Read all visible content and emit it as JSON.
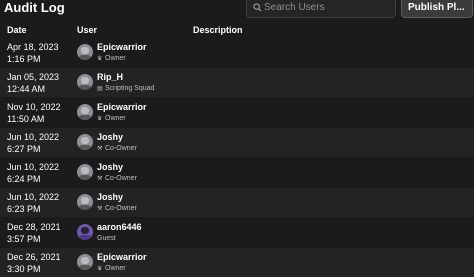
{
  "header": {
    "title": "Audit Log",
    "search_placeholder": "Search Users",
    "publish_label": "Publish Pl..."
  },
  "columns": {
    "date": "Date",
    "user": "User",
    "description": "Description"
  },
  "rows": [
    {
      "date": "Apr 18, 2023",
      "time": "1:16 PM",
      "user": "Epicwarrior",
      "role": "Owner",
      "role_icon": "crown-icon",
      "avatar": "gray"
    },
    {
      "date": "Jan 05, 2023",
      "time": "12:44 AM",
      "user": "Rip_H",
      "role": "Scripting Squad",
      "role_icon": "script-icon",
      "avatar": "gray"
    },
    {
      "date": "Nov 10, 2022",
      "time": "11:50 AM",
      "user": "Epicwarrior",
      "role": "Owner",
      "role_icon": "crown-icon",
      "avatar": "gray"
    },
    {
      "date": "Jun 10, 2022",
      "time": "6:27 PM",
      "user": "Joshy",
      "role": "Co-Owner",
      "role_icon": "wrench-icon",
      "avatar": "gray"
    },
    {
      "date": "Jun 10, 2022",
      "time": "6:24 PM",
      "user": "Joshy",
      "role": "Co-Owner",
      "role_icon": "wrench-icon",
      "avatar": "gray"
    },
    {
      "date": "Jun 10, 2022",
      "time": "6:23 PM",
      "user": "Joshy",
      "role": "Co-Owner",
      "role_icon": "wrench-icon",
      "avatar": "gray"
    },
    {
      "date": "Dec 28, 2021",
      "time": "3:57 PM",
      "user": "aaron6446",
      "role": "Guest",
      "role_icon": "",
      "avatar": "purple"
    },
    {
      "date": "Dec 26, 2021",
      "time": "3:30 PM",
      "user": "Epicwarrior",
      "role": "Owner",
      "role_icon": "crown-icon",
      "avatar": "gray"
    }
  ]
}
